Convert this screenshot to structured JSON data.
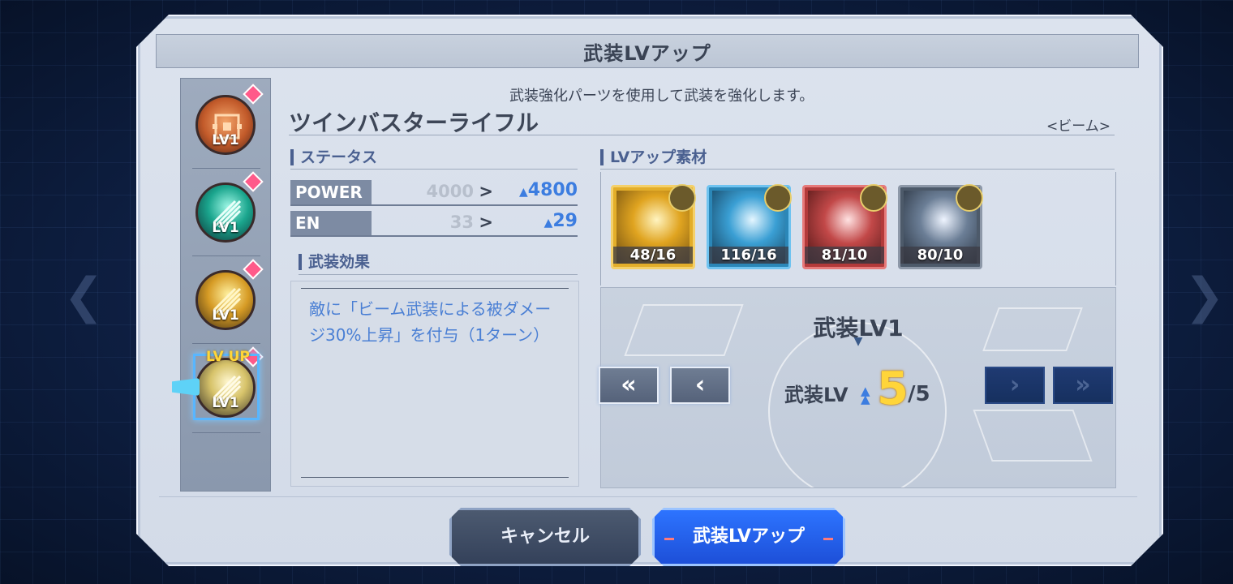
{
  "header": {
    "title": "武装LVアップ"
  },
  "subtitle": "武装強化パーツを使用して武装を強化します。",
  "weapon": {
    "name": "ツインバスターライフル",
    "type": "<ビーム>"
  },
  "weapon_list": {
    "items": [
      {
        "level": "LV1",
        "color": "#d96a34",
        "icon": "cross-target-icon"
      },
      {
        "level": "LV1",
        "color": "#19b79a",
        "icon": "beam-burst-icon"
      },
      {
        "level": "LV1",
        "color": "#e0a229",
        "icon": "beam-burst-icon"
      },
      {
        "level": "LV1",
        "color": "#e5d27e",
        "icon": "beam-burst-icon",
        "badge": "LV UP"
      }
    ]
  },
  "status": {
    "title": "ステータス",
    "rows": [
      {
        "label": "POWER",
        "old": "4000",
        "arrow": ">",
        "new": "4800"
      },
      {
        "label": "EN",
        "old": "33",
        "arrow": ">",
        "new": "29"
      }
    ]
  },
  "effect": {
    "title": "武装効果",
    "text": "敵に「ビーム武装による被ダメージ30%上昇」を付与（1ターン）"
  },
  "materials": {
    "title": "LVアップ素材",
    "items": [
      {
        "count": "48/16",
        "color": "#e3ae2a"
      },
      {
        "count": "116/16",
        "color": "#2b87b8"
      },
      {
        "count": "81/10",
        "color": "#b33a3a"
      },
      {
        "count": "80/10",
        "color": "#4d5a6a"
      }
    ]
  },
  "level_panel": {
    "current_label": "武装LV1",
    "target_prefix": "武装LV",
    "target_value": "5",
    "target_max": "/5"
  },
  "buttons": {
    "cancel": "キャンセル",
    "confirm": "武装LVアップ"
  }
}
